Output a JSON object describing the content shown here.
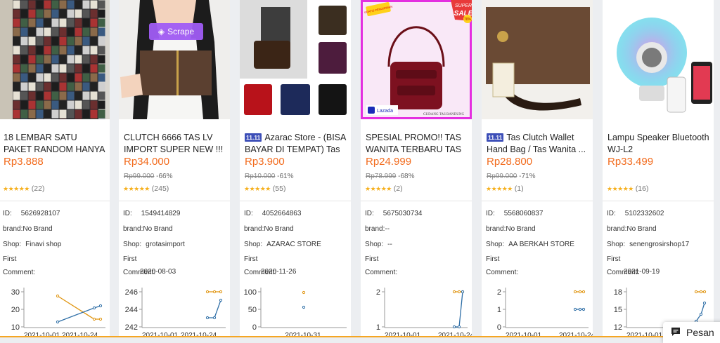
{
  "products": [
    {
      "title": "18 LEMBAR SATU PAKET RANDOM HANYA HARI IN...",
      "mall": "",
      "price": "Rp3.888",
      "original_price": "",
      "discount": "",
      "rating_count": "(22)",
      "id": "5626928107",
      "brand": "No Brand",
      "shop": "Finavi shop",
      "first": "",
      "comment": "",
      "chart": {
        "yticks": [
          "30",
          "20",
          "10"
        ],
        "xticks": [
          "2021-10-01",
          "2021-10-24"
        ]
      }
    },
    {
      "title": "CLUTCH 6666 TAS LV IMPORT SUPER NEW !!! ...",
      "mall": "",
      "price": "Rp34.000",
      "original_price": "Rp99.000",
      "discount": "-66%",
      "rating_count": "(245)",
      "id": "1549414829",
      "brand": "No Brand",
      "shop": "grotasimport",
      "first": "2020-08-03",
      "comment": "",
      "chart": {
        "yticks": [
          "246",
          "244",
          "242"
        ],
        "xticks": [
          "2021-10-01",
          "2021-10-24"
        ]
      }
    },
    {
      "title": "Azarac Store - (BISA BAYAR DI TEMPAT) Tas ...",
      "mall": "11.11",
      "price": "Rp3.900",
      "original_price": "Rp10.000",
      "discount": "-61%",
      "rating_count": "(55)",
      "id": "4052664863",
      "brand": "No Brand",
      "shop": "AZARAC STORE",
      "first": "2020-11-26",
      "comment": "",
      "chart": {
        "yticks": [
          "100",
          "50",
          "0"
        ],
        "xticks": [
          "2021-10-31"
        ]
      }
    },
    {
      "title": "SPESIAL PROMO!! TAS WANITA TERBARU TAS ...",
      "mall": "",
      "price": "Rp24.999",
      "original_price": "Rp78.999",
      "discount": "-68%",
      "rating_count": "(2)",
      "id": "5675030734",
      "brand": "--",
      "shop": "--",
      "first": "",
      "comment": "",
      "chart": {
        "yticks": [
          "2",
          "1"
        ],
        "xticks": [
          "2021-10-01",
          "2021-10-24"
        ]
      }
    },
    {
      "title": "Tas Clutch Wallet Hand Bag / Tas Wanita ...",
      "mall": "11.11",
      "price": "Rp28.800",
      "original_price": "Rp99.000",
      "discount": "-71%",
      "rating_count": "(1)",
      "id": "5568060837",
      "brand": "No Brand",
      "shop": "AA BERKAH STORE",
      "first": "",
      "comment": "",
      "chart": {
        "yticks": [
          "2",
          "1",
          "0"
        ],
        "xticks": [
          "2021-10-01",
          "2021-10-24"
        ]
      }
    },
    {
      "title": "Lampu Speaker Bluetooth WJ-L2",
      "mall": "",
      "price": "Rp33.499",
      "original_price": "",
      "discount": "",
      "rating_count": "(16)",
      "id": "5102332602",
      "brand": "No Brand",
      "shop": "senengrosirshop17",
      "first": "2021-09-19",
      "comment": "",
      "chart": {
        "yticks": [
          "18",
          "15",
          "12"
        ],
        "xticks": [
          "2021-10-01",
          "2021-10-24"
        ]
      }
    }
  ],
  "labels": {
    "id": "ID:",
    "brand": "brand:",
    "shop": "Shop:",
    "first": "First",
    "comment": "Comment:",
    "stars": "★★★★★"
  },
  "overlays": {
    "scrape": "Scrape",
    "sale_top": "SUPER",
    "sale_mid": "SALE",
    "sale_pct": "70%",
    "sale_ribbon": "GRATIS PENGIRIMAN",
    "lazada": "Lazada",
    "bag_caption": "GUDANG TAS BANDUNG"
  },
  "pesan": "Pesan",
  "colors": {
    "price": "#f26b1d",
    "line_orange": "#e09510",
    "line_blue": "#2f6fa7",
    "scrape_purple": "#a05cf5"
  }
}
